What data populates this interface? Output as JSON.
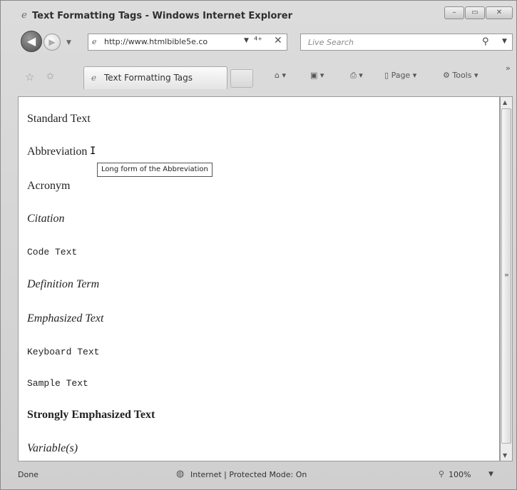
{
  "window": {
    "title": "Text Formatting Tags - Windows Internet Explorer"
  },
  "nav": {
    "address": "http://www.htmlbible5e.co",
    "search_placeholder": "Live Search"
  },
  "tab": {
    "label": "Text Formatting Tags"
  },
  "toolbar": {
    "page_label": "Page",
    "tools_label": "Tools"
  },
  "content": {
    "lines": [
      "Standard Text",
      "Abbreviation",
      "Acronym",
      "Citation",
      "Code Text",
      "Definition Term",
      "Emphasized Text",
      "Keyboard Text",
      "Sample Text",
      "Strongly Emphasized Text",
      "Variable(s)"
    ],
    "tooltip": "Long form of the Abbreviation"
  },
  "status": {
    "text": "Done",
    "zone": "Internet | Protected Mode: On",
    "zoom": "100%"
  }
}
